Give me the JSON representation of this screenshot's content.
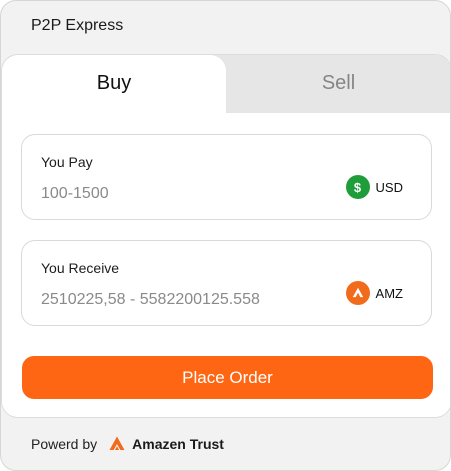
{
  "header": {
    "title": "P2P Express"
  },
  "tabs": [
    {
      "label": "Buy",
      "active": true
    },
    {
      "label": "Sell",
      "active": false
    }
  ],
  "pay": {
    "label": "You Pay",
    "placeholder": "100-1500",
    "currency": {
      "code": "USD",
      "icon": "dollar-icon",
      "color": "#1f9d3a"
    }
  },
  "receive": {
    "label": "You Receive",
    "placeholder": "2510225,58 - 5582200125.558",
    "currency": {
      "code": "AMZ",
      "icon": "amz-logo-icon",
      "color": "#f26a1b"
    }
  },
  "action": {
    "place_order_label": "Place Order",
    "color": "#ff6614"
  },
  "footer": {
    "powered_label": "Powerd by",
    "brand": "Amazen Trust",
    "brand_icon": "amazen-logo-icon"
  }
}
